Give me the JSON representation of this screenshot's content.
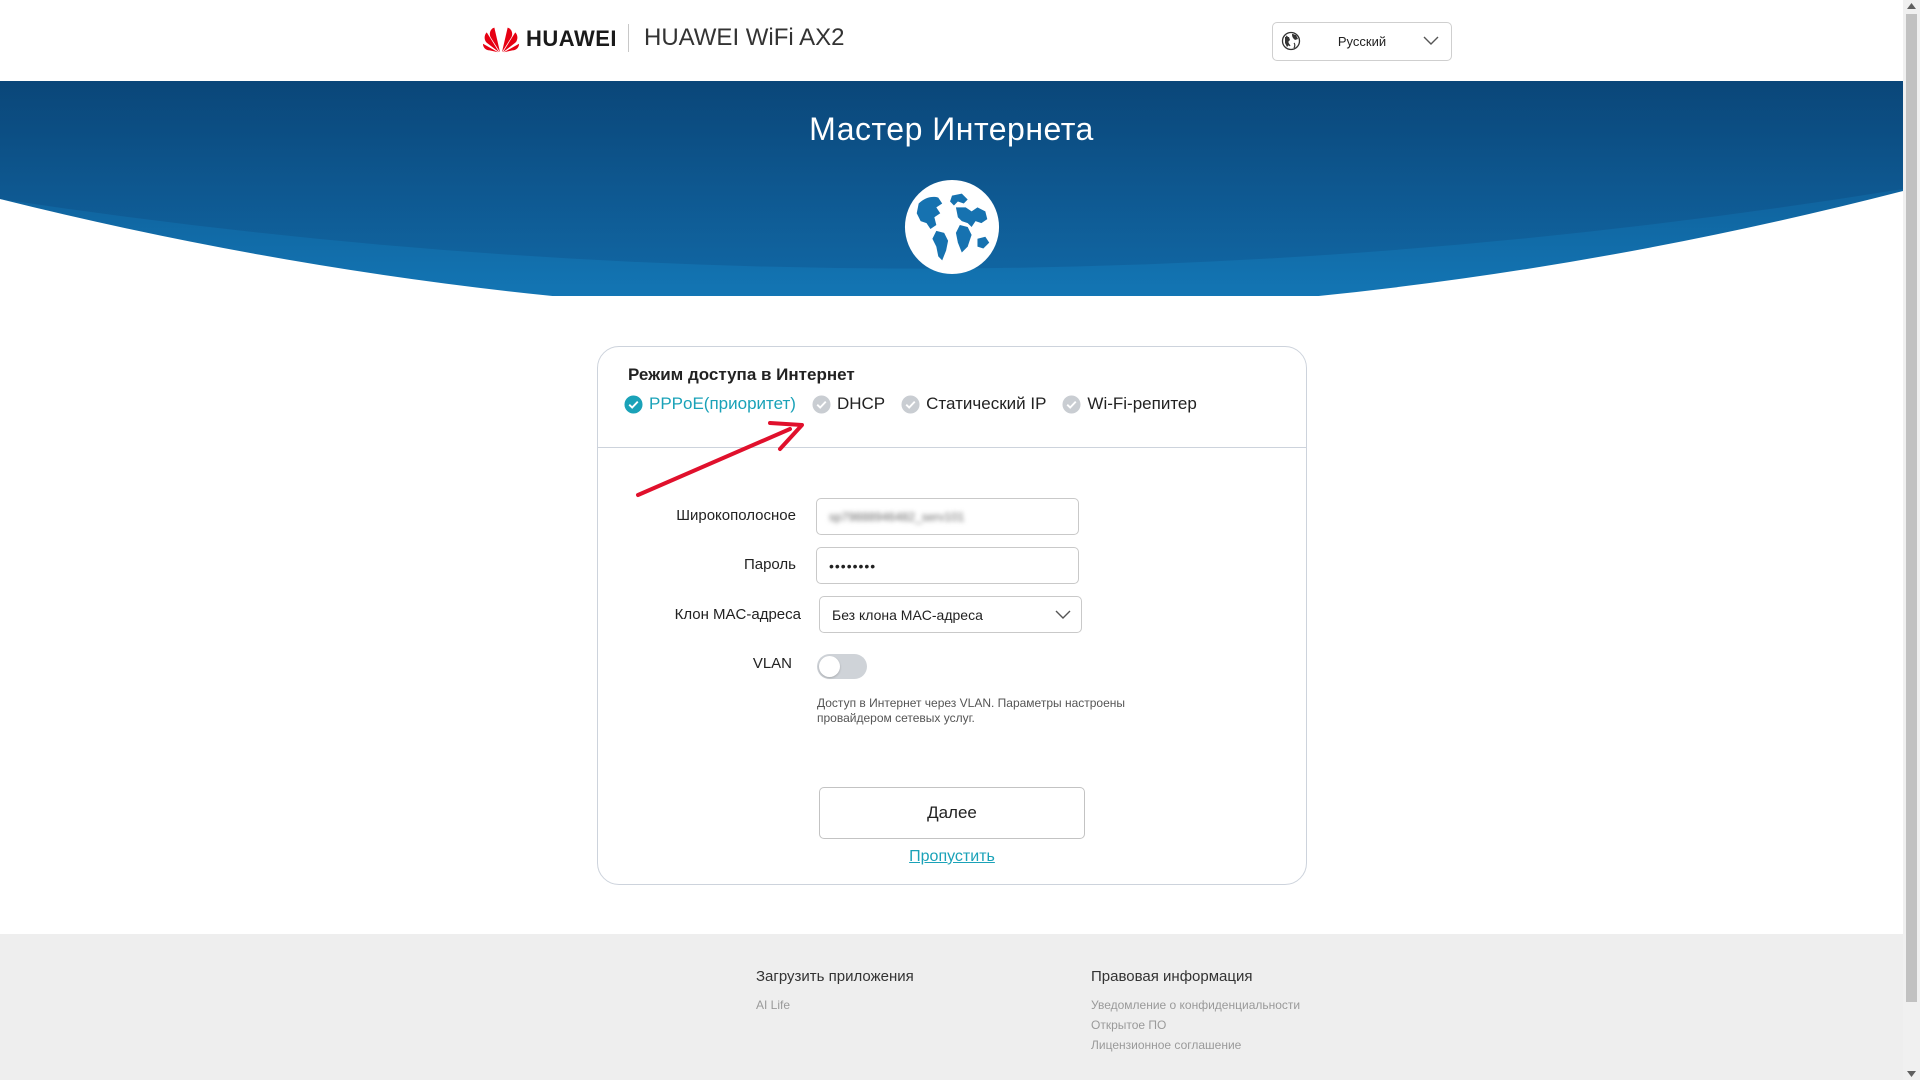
{
  "header": {
    "brand": "HUAWEI",
    "product": "HUAWEI WiFi AX2",
    "language": "Русский",
    "brand_color": "#e60012"
  },
  "hero": {
    "title": "Мастер Интернета",
    "colors": {
      "top": "#0b4f86",
      "bottom": "#1479b8"
    }
  },
  "form": {
    "section_title": "Режим доступа в Интернет",
    "modes": [
      {
        "label": "PPPoE(приоритет)",
        "selected": true
      },
      {
        "label": "DHCP",
        "selected": false
      },
      {
        "label": "Статический IP",
        "selected": false
      },
      {
        "label": "Wi-Fi-репитер",
        "selected": false
      }
    ],
    "broadband_label": "Широкополосное",
    "broadband_value": "sp79888946482_serv101",
    "password_label": "Пароль",
    "password_value": "••••••••",
    "mac_label": "Клон MAC-адреса",
    "mac_value": "Без клона MAC-адреса",
    "vlan_label": "VLAN",
    "vlan_enabled": false,
    "vlan_hint": "Доступ в Интернет через VLAN. Параметры настроены провайдером сетевых услуг.",
    "next_label": "Далее",
    "skip_label": "Пропустить",
    "accent_color": "#1aa2b8"
  },
  "annotation": {
    "arrow_color": "#e0102c"
  },
  "footer": {
    "apps_title": "Загрузить приложения",
    "apps_links": [
      "AI Life"
    ],
    "legal_title": "Правовая информация",
    "legal_links": [
      "Уведомление о конфиденциальности",
      "Открытое ПО",
      "Лицензионное соглашение"
    ]
  }
}
